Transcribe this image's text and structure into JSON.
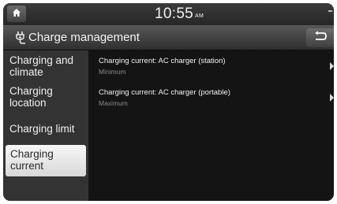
{
  "status_bar": {
    "time": "10:55",
    "ampm": "AM"
  },
  "header": {
    "title": "Charge management"
  },
  "sidebar": {
    "items": [
      {
        "label": "Charging and climate",
        "active": false
      },
      {
        "label": "Charging location",
        "active": false
      },
      {
        "label": "Charging limit",
        "active": false
      },
      {
        "label": "Charging current",
        "active": true
      }
    ]
  },
  "content": {
    "rows": [
      {
        "label": "Charging current: AC charger (station)",
        "value": "Minimum"
      },
      {
        "label": "Charging current: AC charger (portable)",
        "value": "Maximum"
      }
    ]
  },
  "colors": {
    "background": "#1e1e1e",
    "sidebar": "#333333",
    "content": "#141414",
    "active_item": "#e6e6e6"
  },
  "icons": {
    "home": "home-icon",
    "title": "charge-plug-icon",
    "back": "back-arrow-icon",
    "row_arrow": "triangle-right-icon"
  }
}
